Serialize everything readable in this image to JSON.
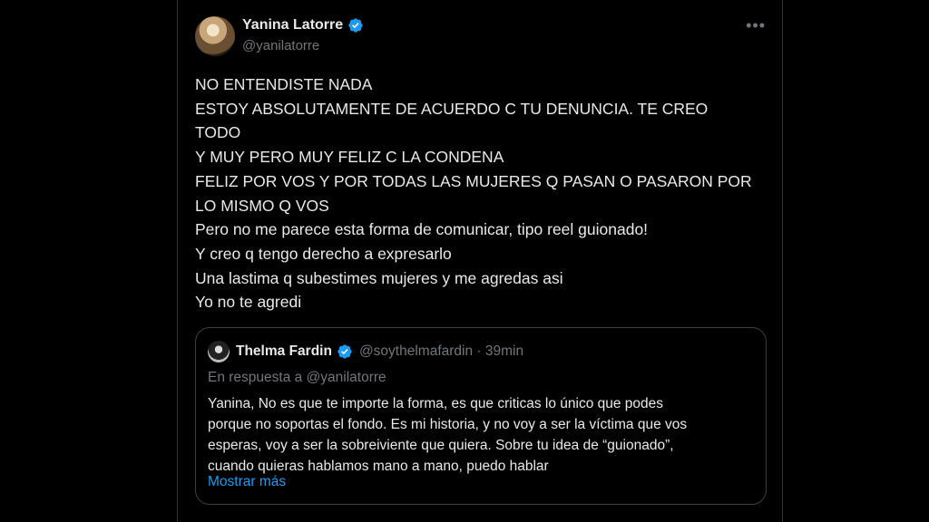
{
  "tweet": {
    "author_name": "Yanina Latorre",
    "author_handle": "@yanilatorre",
    "more_icon": "more-horizontal-icon",
    "verified_color": "#1d9bf0",
    "lines": [
      "NO ENTENDISTE NADA",
      "ESTOY ABSOLUTAMENTE DE ACUERDO C TU DENUNCIA. TE CREO",
      "TODO",
      "Y MUY PERO MUY FELIZ C LA CONDENA",
      "FELIZ POR VOS Y POR TODAS LAS MUJERES Q PASAN O PASARON POR",
      "LO MISMO Q VOS",
      "Pero no me parece esta forma de comunicar, tipo reel guionado!",
      "Y creo q tengo derecho a expresarlo",
      "Una lastima q subestimes mujeres y me agredas asi",
      "Yo no te agredi"
    ]
  },
  "quote": {
    "author_name": "Thelma Fardin",
    "author_handle_time": "@soythelmafardin · 39min",
    "reply_to": "En respuesta a @yanilatorre",
    "lines": [
      "Yanina, No es que te importe la forma, es que criticas lo único que podes",
      "porque no soportas el fondo. Es mi historia, y no voy a ser la víctima que vos",
      "esperas, voy a ser la sobreiviente que quiera. Sobre tu idea de “guionado”,",
      "cuando quieras hablamos mano a mano, puedo hablar"
    ],
    "show_more": "Mostrar más",
    "link_color": "#1d9bf0"
  }
}
